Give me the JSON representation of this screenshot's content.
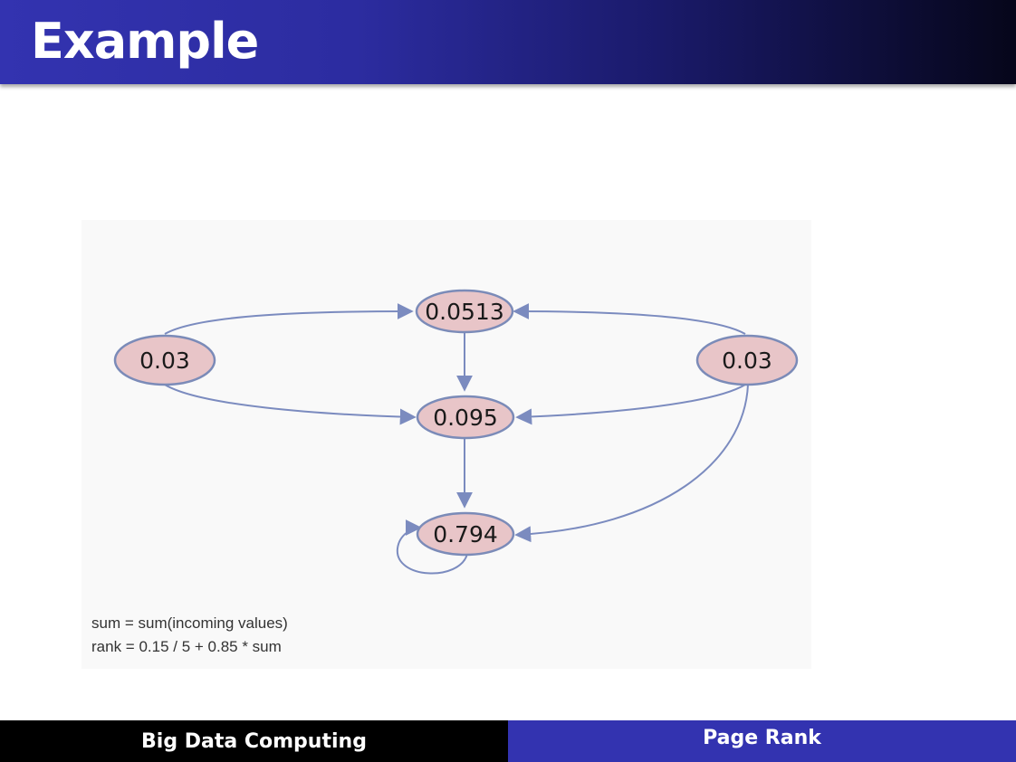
{
  "slide": {
    "title": "Example"
  },
  "diagram": {
    "nodes": [
      {
        "id": "top",
        "label": "0.0513"
      },
      {
        "id": "left",
        "label": "0.03"
      },
      {
        "id": "right",
        "label": "0.03"
      },
      {
        "id": "middle",
        "label": "0.095"
      },
      {
        "id": "bottom",
        "label": "0.794"
      }
    ],
    "edges": [
      {
        "from": "left",
        "to": "top"
      },
      {
        "from": "right",
        "to": "top"
      },
      {
        "from": "top",
        "to": "middle"
      },
      {
        "from": "left",
        "to": "middle"
      },
      {
        "from": "right",
        "to": "middle"
      },
      {
        "from": "middle",
        "to": "bottom"
      },
      {
        "from": "right",
        "to": "bottom"
      },
      {
        "from": "bottom",
        "to": "bottom"
      }
    ],
    "formula_line1": "sum = sum(incoming values)",
    "formula_line2": "rank = 0.15 / 5 + 0.85 * sum",
    "colors": {
      "node_fill": "#e8c5c8",
      "node_stroke": "#7b8bb8",
      "edge": "#7b8bbf"
    }
  },
  "footer": {
    "left_text": "Big Data Computing",
    "right_text": "Page Rank"
  }
}
